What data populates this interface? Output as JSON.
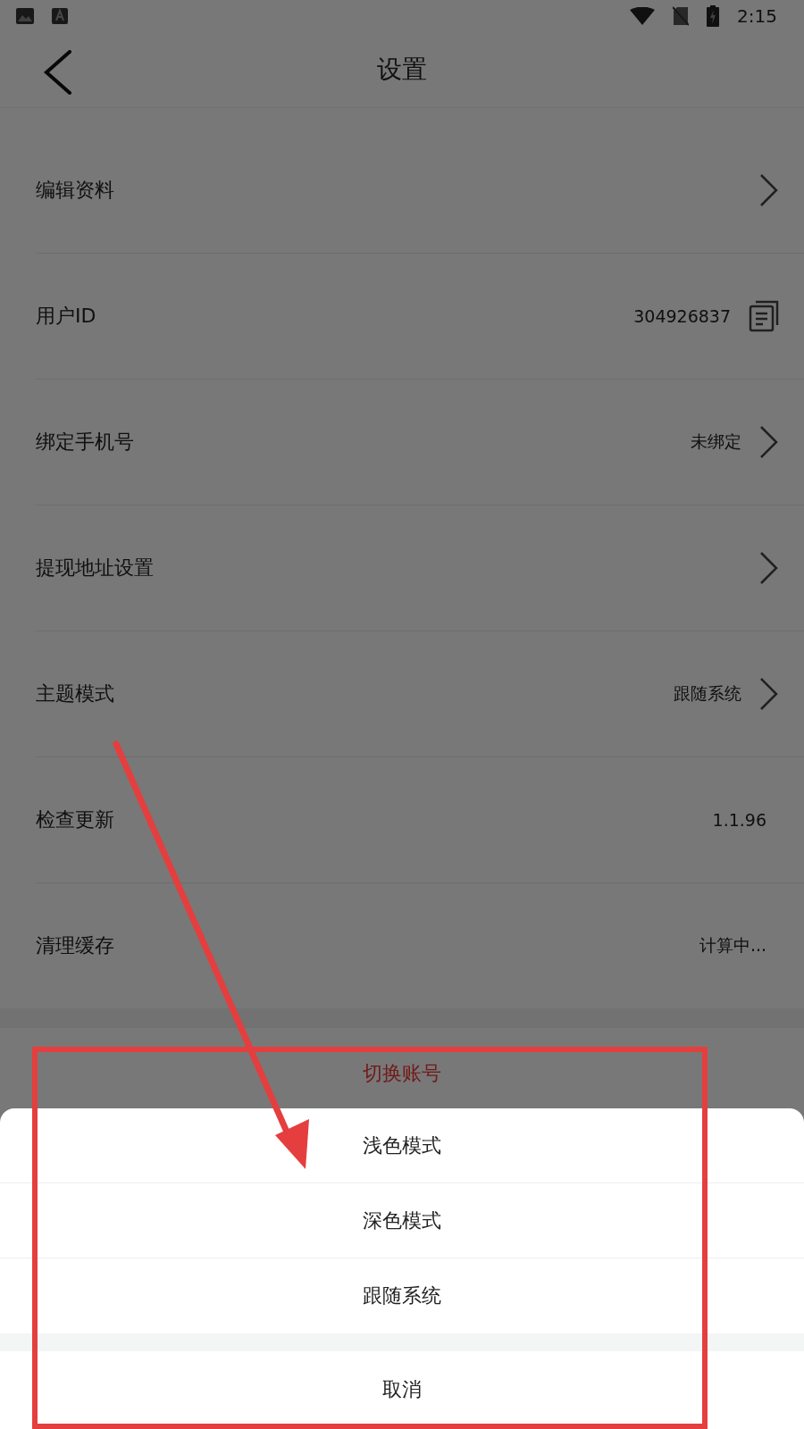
{
  "status_bar": {
    "time": "2:15"
  },
  "header": {
    "title": "设置"
  },
  "rows": [
    {
      "label": "编辑资料",
      "kind": "link"
    },
    {
      "label": "用户ID",
      "value": "304926837",
      "kind": "copy"
    },
    {
      "label": "绑定手机号",
      "value": "未绑定",
      "kind": "link"
    },
    {
      "label": "提现地址设置",
      "kind": "link"
    },
    {
      "label": "主题模式",
      "value": "跟随系统",
      "kind": "link"
    },
    {
      "label": "检查更新",
      "value": "1.1.96",
      "kind": "plain"
    },
    {
      "label": "清理缓存",
      "value": "计算中...",
      "kind": "plain"
    }
  ],
  "switch_account": "切换账号",
  "sheet": {
    "options": [
      "浅色模式",
      "深色模式",
      "跟随系统"
    ],
    "cancel": "取消"
  }
}
